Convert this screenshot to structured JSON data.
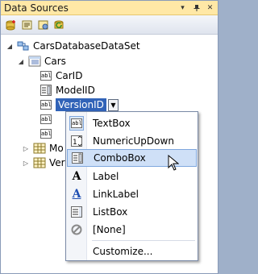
{
  "window": {
    "title": "Data Sources"
  },
  "title_controls": [
    "dropdown-icon",
    "pin-icon",
    "close-icon"
  ],
  "toolbar": {
    "buttons": [
      "add-data-source-icon",
      "edit-dataset-icon",
      "configure-dataset-icon",
      "refresh-icon"
    ]
  },
  "tree": {
    "dataset": "CarsDatabaseDataSet",
    "table": "Cars",
    "fields": [
      "CarID",
      "ModelID",
      "VersionID"
    ],
    "partial_nodes": [
      "Mo",
      "Ver"
    ]
  },
  "menu": {
    "items": [
      {
        "label": "TextBox",
        "icon": "textbox-icon",
        "checked": true
      },
      {
        "label": "NumericUpDown",
        "icon": "numeric-updown-icon"
      },
      {
        "label": "ComboBox",
        "icon": "combobox-icon",
        "hovered": true
      },
      {
        "label": "Label",
        "icon": "label-icon"
      },
      {
        "label": "LinkLabel",
        "icon": "linklabel-icon"
      },
      {
        "label": "ListBox",
        "icon": "listbox-icon"
      },
      {
        "label": "[None]",
        "icon": "none-icon"
      }
    ],
    "customize": "Customize..."
  },
  "colors": {
    "selection": "#3163b8",
    "hover": "#cfe0f7",
    "titlebar": "#ffe8a6"
  }
}
